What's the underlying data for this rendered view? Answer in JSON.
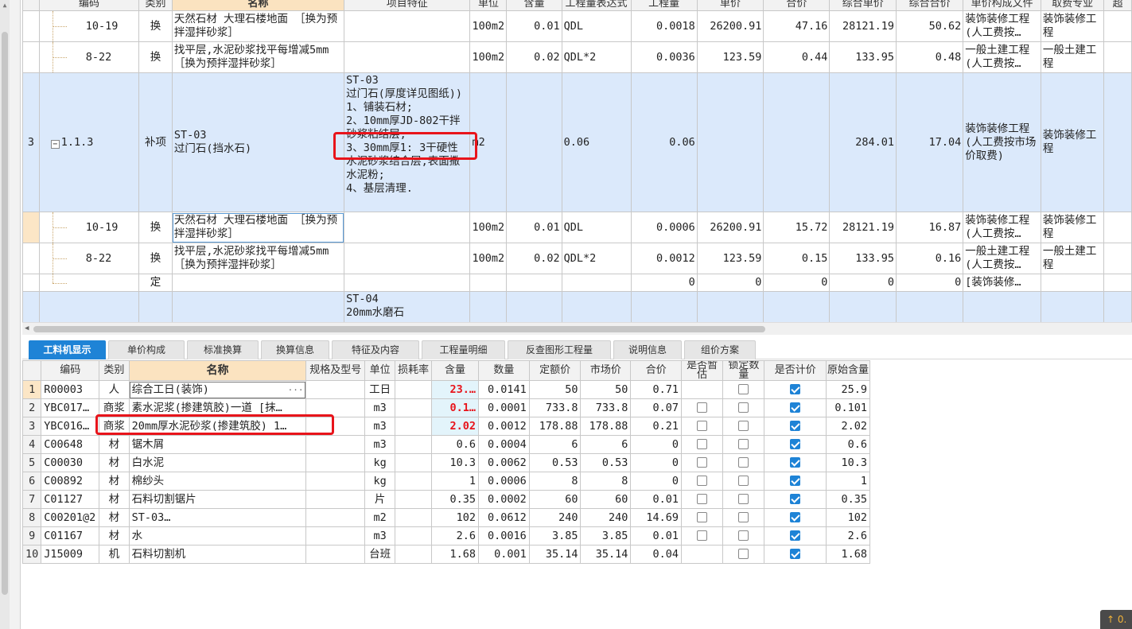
{
  "upper_headers": {
    "code": "编码",
    "type": "类别",
    "name": "名称",
    "feature": "项目特征",
    "unit": "单位",
    "content": "含量",
    "expr": "工程量表达式",
    "qty": "工程量",
    "price": "单价",
    "total": "合价",
    "comp_price": "综合单价",
    "comp_total": "综合合价",
    "price_file": "单价构成文件",
    "fee_prof": "取费专业",
    "extra": "超"
  },
  "upper_rows": [
    {
      "code": "10-19",
      "type": "换",
      "name": "天然石材 大理石楼地面 ［换为预拌湿拌砂浆］",
      "feature": "",
      "unit": "100m2",
      "content": "0.01",
      "expr": "QDL",
      "qty": "0.0018",
      "price": "26200.91",
      "total": "47.16",
      "comp_price": "28121.19",
      "comp_total": "50.62",
      "price_file": "装饰装修工程(人工费按…",
      "fee_prof": "装饰装修工程"
    },
    {
      "code": "8-22",
      "type": "换",
      "name": "找平层,水泥砂浆找平每增减5mm ［换为预拌湿拌砂浆］",
      "feature": "",
      "unit": "100m2",
      "content": "0.02",
      "expr": "QDL*2",
      "qty": "0.0036",
      "price": "123.59",
      "total": "0.44",
      "comp_price": "133.95",
      "comp_total": "0.48",
      "price_file": "一般土建工程(人工费按…",
      "fee_prof": "一般土建工程"
    },
    {
      "rownum": "3",
      "expander": "−",
      "code": "1.1.3",
      "type": "补项",
      "name": "ST-03\n过门石(挡水石)",
      "feature": "ST-03\n过门石(厚度详见图纸))\n1、铺装石材;\n2、10mm厚JD-802干拌砂浆粘结层;\n3、30mm厚1: 3干硬性水泥砂浆结合层,表面撒水泥粉;\n4、基层清理.",
      "unit": "m2",
      "content": "",
      "expr": "0.06",
      "qty": "0.06",
      "price": "",
      "total": "",
      "comp_price": "284.01",
      "comp_total": "17.04",
      "price_file": "装饰装修工程(人工费按市场价取费)",
      "fee_prof": "装饰装修工程"
    },
    {
      "code": "10-19",
      "type": "换",
      "name": "天然石材 大理石楼地面 ［换为预拌湿拌砂浆］",
      "feature": "",
      "unit": "100m2",
      "content": "0.01",
      "expr": "QDL",
      "qty": "0.0006",
      "price": "26200.91",
      "total": "15.72",
      "comp_price": "28121.19",
      "comp_total": "16.87",
      "price_file": "装饰装修工程(人工费按…",
      "fee_prof": "装饰装修工程"
    },
    {
      "code": "8-22",
      "type": "换",
      "name": "找平层,水泥砂浆找平每增减5mm ［换为预拌湿拌砂浆］",
      "feature": "",
      "unit": "100m2",
      "content": "0.02",
      "expr": "QDL*2",
      "qty": "0.0012",
      "price": "123.59",
      "total": "0.15",
      "comp_price": "133.95",
      "comp_total": "0.16",
      "price_file": "一般土建工程(人工费按…",
      "fee_prof": "一般土建工程"
    },
    {
      "code": "",
      "type": "定",
      "name": "",
      "feature": "",
      "unit": "",
      "content": "",
      "expr": "",
      "qty": "0",
      "price": "0",
      "total": "0",
      "comp_price": "0",
      "comp_total": "0",
      "price_file": "[装饰装修…",
      "fee_prof": ""
    },
    {
      "code": "",
      "type": "",
      "name": "",
      "feature": "ST-04\n20mm水磨石",
      "unit": "",
      "content": "",
      "expr": "",
      "qty": "",
      "price": "",
      "total": "",
      "comp_price": "",
      "comp_total": "",
      "price_file": "",
      "fee_prof": ""
    }
  ],
  "tabs": [
    "工料机显示",
    "单价构成",
    "标准换算",
    "换算信息",
    "特征及内容",
    "工程量明细",
    "反查图形工程量",
    "说明信息",
    "组价方案"
  ],
  "lower_headers": {
    "code": "编码",
    "type": "类别",
    "name": "名称",
    "spec": "规格及型号",
    "unit": "单位",
    "loss": "损耗率",
    "content": "含量",
    "qty": "数量",
    "quota_price": "定额价",
    "market_price": "市场价",
    "total": "合价",
    "is_temp": "是否暂估",
    "lock_qty": "锁定数量",
    "is_priced": "是否计价",
    "orig_content": "原始含量"
  },
  "lower_rows": [
    {
      "n": "1",
      "code": "R00003",
      "type": "人",
      "name": "综合工日(装饰)",
      "unit": "工日",
      "content": "23.…",
      "content_red": true,
      "qty": "0.0141",
      "quota_price": "50",
      "market_price": "50",
      "total": "0.71",
      "is_temp": null,
      "lock_qty": false,
      "is_priced": true,
      "orig": "25.9"
    },
    {
      "n": "2",
      "code": "YBC017…",
      "type": "商浆",
      "name": "素水泥浆(掺建筑胶)一道 [抹…",
      "unit": "m3",
      "content": "0.1…",
      "content_red": true,
      "qty": "0.0001",
      "quota_price": "733.8",
      "market_price": "733.8",
      "total": "0.07",
      "is_temp": false,
      "lock_qty": false,
      "is_priced": true,
      "orig": "0.101"
    },
    {
      "n": "3",
      "code": "YBC016…",
      "type": "商浆",
      "name": "20mm厚水泥砂浆(掺建筑胶) 1…",
      "unit": "m3",
      "content": "2.02",
      "content_red": true,
      "qty": "0.0012",
      "quota_price": "178.88",
      "market_price": "178.88",
      "total": "0.21",
      "is_temp": false,
      "lock_qty": false,
      "is_priced": true,
      "orig": "2.02"
    },
    {
      "n": "4",
      "code": "C00648",
      "type": "材",
      "name": "锯木屑",
      "unit": "m3",
      "content": "0.6",
      "content_red": false,
      "qty": "0.0004",
      "quota_price": "6",
      "market_price": "6",
      "total": "0",
      "is_temp": false,
      "lock_qty": false,
      "is_priced": true,
      "orig": "0.6"
    },
    {
      "n": "5",
      "code": "C00030",
      "type": "材",
      "name": "白水泥",
      "unit": "kg",
      "content": "10.3",
      "content_red": false,
      "qty": "0.0062",
      "quota_price": "0.53",
      "market_price": "0.53",
      "total": "0",
      "is_temp": false,
      "lock_qty": false,
      "is_priced": true,
      "orig": "10.3"
    },
    {
      "n": "6",
      "code": "C00892",
      "type": "材",
      "name": "棉纱头",
      "unit": "kg",
      "content": "1",
      "content_red": false,
      "qty": "0.0006",
      "quota_price": "8",
      "market_price": "8",
      "total": "0",
      "is_temp": false,
      "lock_qty": false,
      "is_priced": true,
      "orig": "1"
    },
    {
      "n": "7",
      "code": "C01127",
      "type": "材",
      "name": "石料切割锯片",
      "unit": "片",
      "content": "0.35",
      "content_red": false,
      "qty": "0.0002",
      "quota_price": "60",
      "market_price": "60",
      "total": "0.01",
      "is_temp": false,
      "lock_qty": false,
      "is_priced": true,
      "orig": "0.35"
    },
    {
      "n": "8",
      "code": "C00201@2",
      "type": "材",
      "name": "ST-03…",
      "unit": "m2",
      "content": "102",
      "content_red": false,
      "qty": "0.0612",
      "quota_price": "240",
      "market_price": "240",
      "total": "14.69",
      "is_temp": false,
      "lock_qty": false,
      "is_priced": true,
      "orig": "102"
    },
    {
      "n": "9",
      "code": "C01167",
      "type": "材",
      "name": "水",
      "unit": "m3",
      "content": "2.6",
      "content_red": false,
      "qty": "0.0016",
      "quota_price": "3.85",
      "market_price": "3.85",
      "total": "0.01",
      "is_temp": false,
      "lock_qty": false,
      "is_priced": true,
      "orig": "2.6"
    },
    {
      "n": "10",
      "code": "J15009",
      "type": "机",
      "name": "石料切割机",
      "unit": "台班",
      "content": "1.68",
      "content_red": false,
      "qty": "0.001",
      "quota_price": "35.14",
      "market_price": "35.14",
      "total": "0.04",
      "is_temp": null,
      "lock_qty": false,
      "is_priced": true,
      "orig": "1.68"
    }
  ],
  "corner_widget": "↑ 0.",
  "colors": {
    "accent": "#1e83d6",
    "highlight_row": "#dbe9fb",
    "annotation": "#e8141b",
    "header_name": "#fbe3c0"
  }
}
